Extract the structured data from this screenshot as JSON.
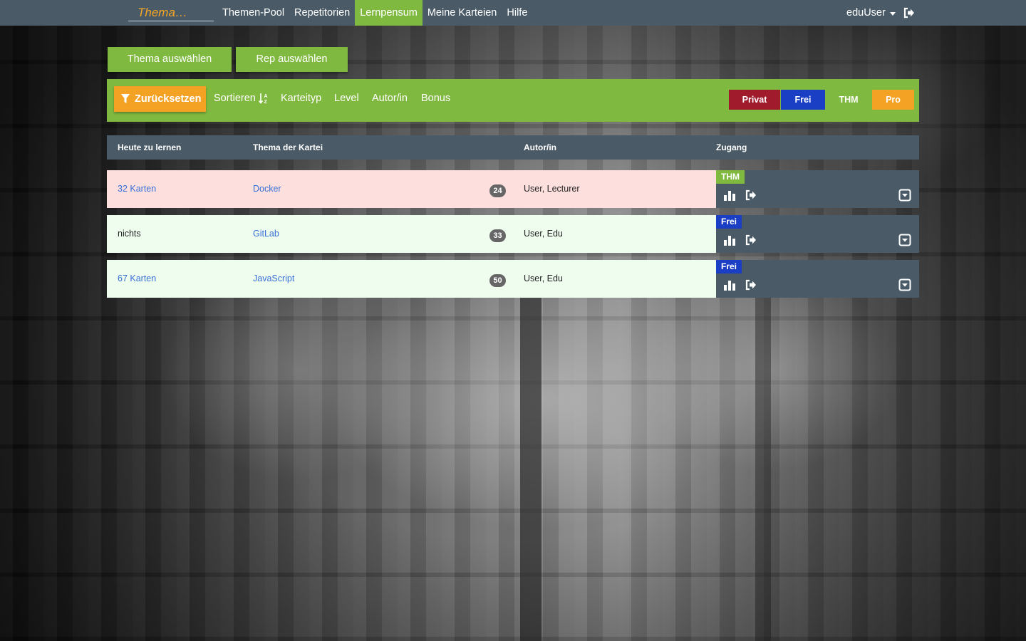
{
  "nav": {
    "brand_placeholder": "Thema…",
    "items": [
      {
        "label": "Themen-Pool",
        "active": false
      },
      {
        "label": "Repetitorien",
        "active": false
      },
      {
        "label": "Lernpensum",
        "active": true
      },
      {
        "label": "Meine Karteien",
        "active": false
      },
      {
        "label": "Hilfe",
        "active": false
      }
    ],
    "user_label": "eduUser",
    "logout_icon": "logout-icon"
  },
  "actions": {
    "select_topic_label": "Thema auswählen",
    "select_rep_label": "Rep auswählen"
  },
  "filters": {
    "reset_label": "Zurücksetzen",
    "sort_label": "Sortieren",
    "card_type_label": "Karteityp",
    "level_label": "Level",
    "author_label": "Autor/in",
    "bonus_label": "Bonus",
    "access_buttons": [
      {
        "label": "Privat",
        "color": "#a01c2c"
      },
      {
        "label": "Frei",
        "color": "#1a3fc4"
      },
      {
        "label": "THM",
        "color": "#80b940"
      },
      {
        "label": "Pro",
        "color": "#f4a223"
      }
    ]
  },
  "table": {
    "headers": [
      "Heute zu lernen",
      "Thema der Kartei",
      "Autor/in",
      "Zugang"
    ],
    "rows": [
      {
        "today": "32 Karten",
        "today_is_link": true,
        "topic": "Docker",
        "count": "24",
        "author": "User, Lecturer",
        "access": "THM",
        "access_color": "#80b940",
        "row_color": "#fde0de"
      },
      {
        "today": "nichts",
        "today_is_link": false,
        "topic": "GitLab",
        "count": "33",
        "author": "User, Edu",
        "access": "Frei",
        "access_color": "#1a3fc4",
        "row_color": "#effdef"
      },
      {
        "today": "67 Karten",
        "today_is_link": true,
        "topic": "JavaScript",
        "count": "50",
        "author": "User, Edu",
        "access": "Frei",
        "access_color": "#1a3fc4",
        "row_color": "#effdef"
      }
    ]
  },
  "colors": {
    "navbar": "#4a5b67",
    "accent_green": "#80b940",
    "accent_orange": "#f4a223",
    "brand_text": "#f5a623"
  }
}
